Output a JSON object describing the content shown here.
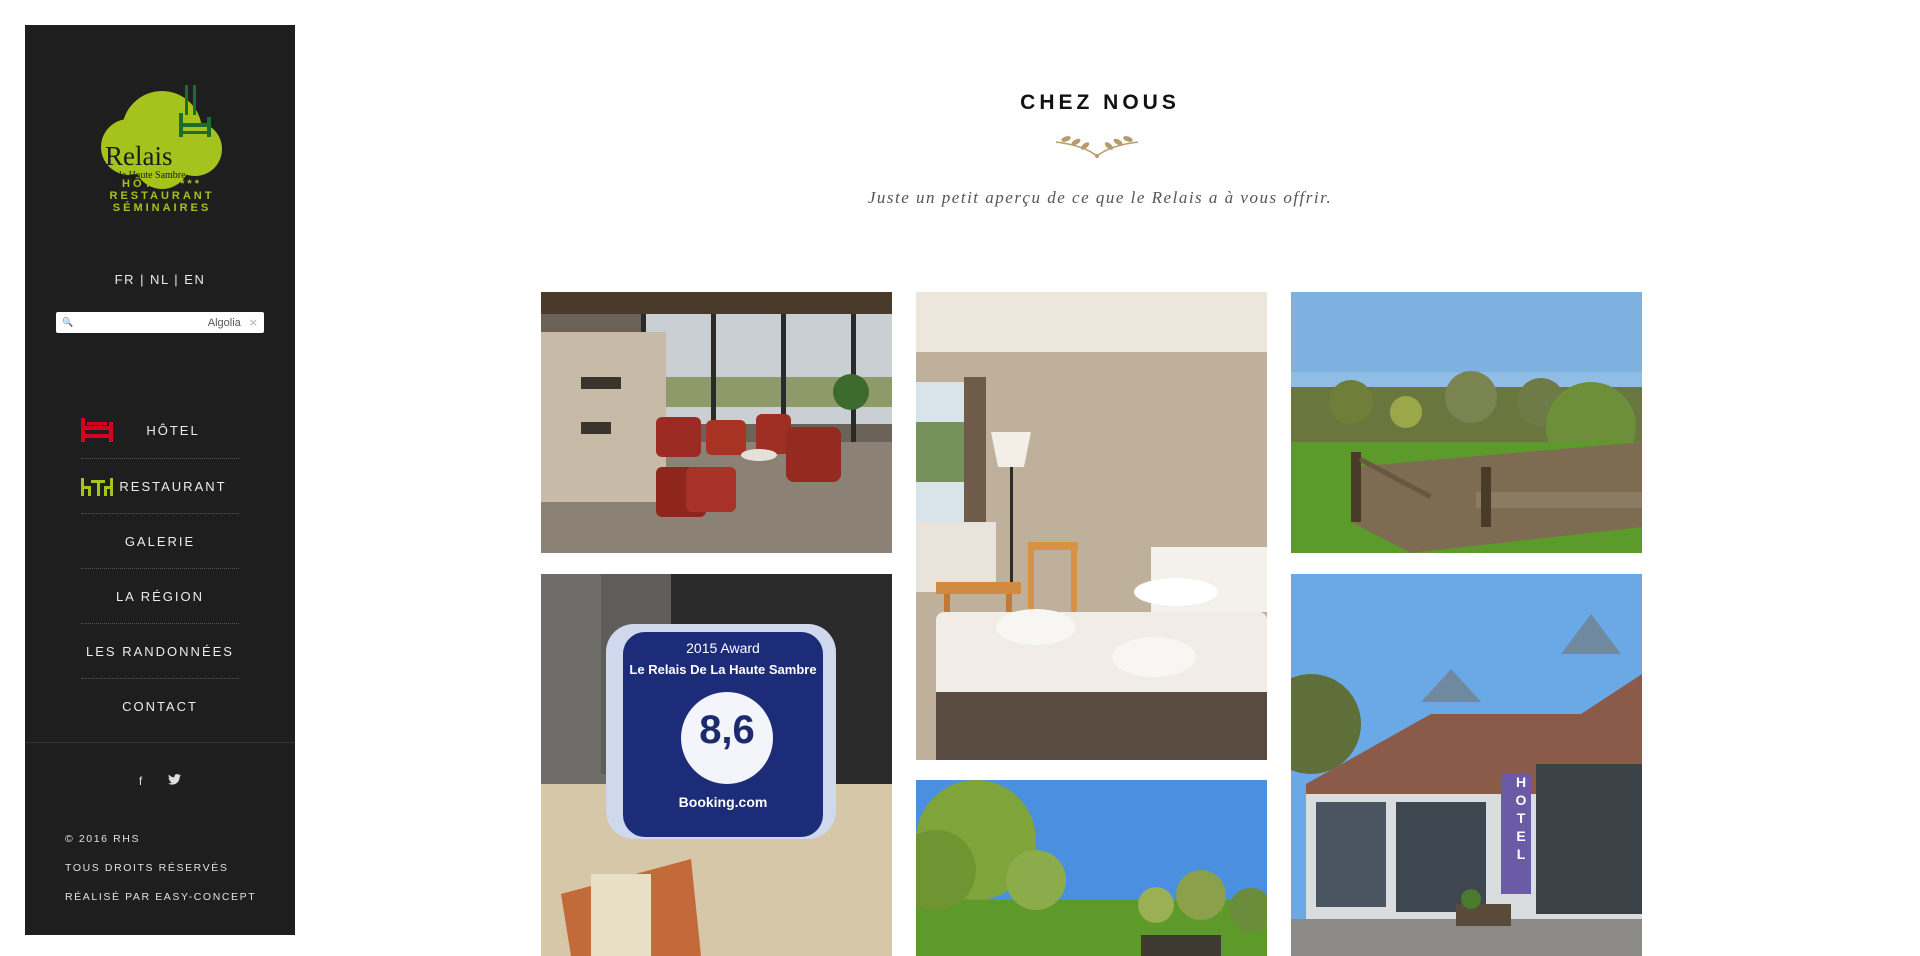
{
  "sidebar": {
    "logo": {
      "name": "Relais",
      "sub": "de la Haute Sambre",
      "stars": "***",
      "line1": "HÔTEL",
      "line2": "RESTAURANT",
      "line3": "SÉMINAIRES"
    },
    "languages": "FR | NL | EN",
    "search": {
      "placeholder": "",
      "brand": "Algolia",
      "clear": "×"
    },
    "menu": [
      {
        "label": "HÔTEL",
        "icon": "bed-icon"
      },
      {
        "label": "RESTAURANT",
        "icon": "table-chairs-icon"
      },
      {
        "label": "GALERIE"
      },
      {
        "label": "LA RÉGION"
      },
      {
        "label": "LES RANDONNÉES"
      },
      {
        "label": "CONTACT"
      }
    ],
    "social": {
      "facebook": "f",
      "twitter": "t"
    },
    "footer": {
      "copyright": "© 2016 RHS",
      "rights": "TOUS DROITS RÉSERVÉS",
      "credit": "RÉALISÉ PAR EASY-CONCEPT"
    }
  },
  "main": {
    "title": "CHEZ NOUS",
    "subtitle": "Juste un petit aperçu de ce que le Relais a à vous offrir.",
    "award": {
      "heading": "2015 Award",
      "name": "Le Relais De La Haute Sambre",
      "score": "8,6",
      "brand": "Booking.com"
    },
    "hotel_sign": "HOTEL"
  },
  "colors": {
    "sidebar_bg": "#1e1e1e",
    "brand_green": "#a5c21d",
    "hotel_red": "#d8001f"
  }
}
